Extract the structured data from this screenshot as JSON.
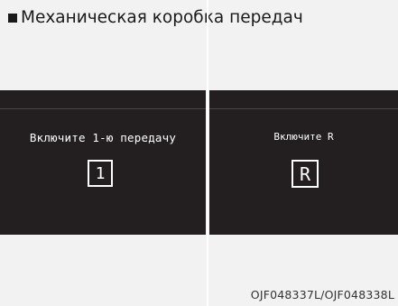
{
  "heading": {
    "title": "Механическая коробка передач",
    "bullet_icon": "black-square"
  },
  "panels": [
    {
      "message": "Включите 1-ю передачу",
      "gear": "1"
    },
    {
      "message": "Включите R",
      "gear": "R"
    }
  ],
  "figure_id": "OJF048337L/OJF048338L",
  "colors": {
    "panel_background": "#231f20",
    "panel_text": "#ffffff",
    "page_background": "#f2f2f2",
    "heading_text": "#1a1a1a"
  }
}
